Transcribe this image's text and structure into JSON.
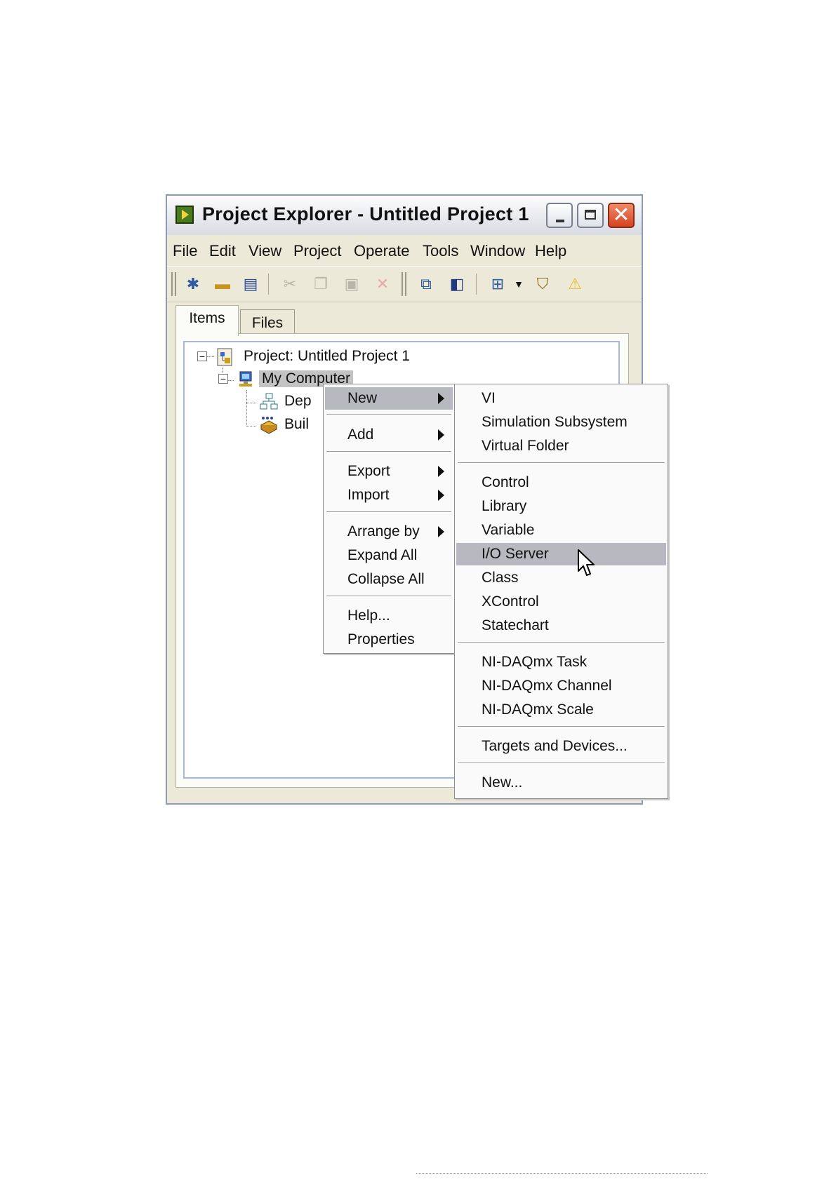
{
  "window": {
    "title": "Project Explorer - Untitled Project 1"
  },
  "menubar": {
    "items": [
      "File",
      "Edit",
      "View",
      "Project",
      "Operate",
      "Tools",
      "Window",
      "Help"
    ]
  },
  "toolbar": {
    "icons": [
      "new-icon",
      "open-icon",
      "save-all-icon",
      "cut-icon",
      "copy-icon",
      "paste-icon",
      "delete-icon",
      "deploy-icon",
      "build-icon",
      "view-options-icon",
      "dropdown-arrow-icon",
      "source-control-icon",
      "warning-icon"
    ]
  },
  "tabs": [
    "Items",
    "Files"
  ],
  "tree": {
    "project_label": "Project: Untitled Project 1",
    "computer_label": "My Computer",
    "dependencies_label": "Dep",
    "build_label": "Buil"
  },
  "context_menu": {
    "items": [
      "New",
      "Add",
      "Export",
      "Import",
      "Arrange by",
      "Expand All",
      "Collapse All",
      "Help...",
      "Properties"
    ]
  },
  "submenu": {
    "items": [
      "VI",
      "Simulation Subsystem",
      "Virtual Folder",
      "Control",
      "Library",
      "Variable",
      "I/O Server",
      "Class",
      "XControl",
      "Statechart",
      "NI-DAQmx Task",
      "NI-DAQmx Channel",
      "NI-DAQmx Scale",
      "Targets and Devices...",
      "New..."
    ],
    "highlighted": "I/O Server"
  },
  "colors": {
    "highlight": "#b8b8c0",
    "window_frame": "#ece9d8",
    "close_button": "#d44322"
  }
}
